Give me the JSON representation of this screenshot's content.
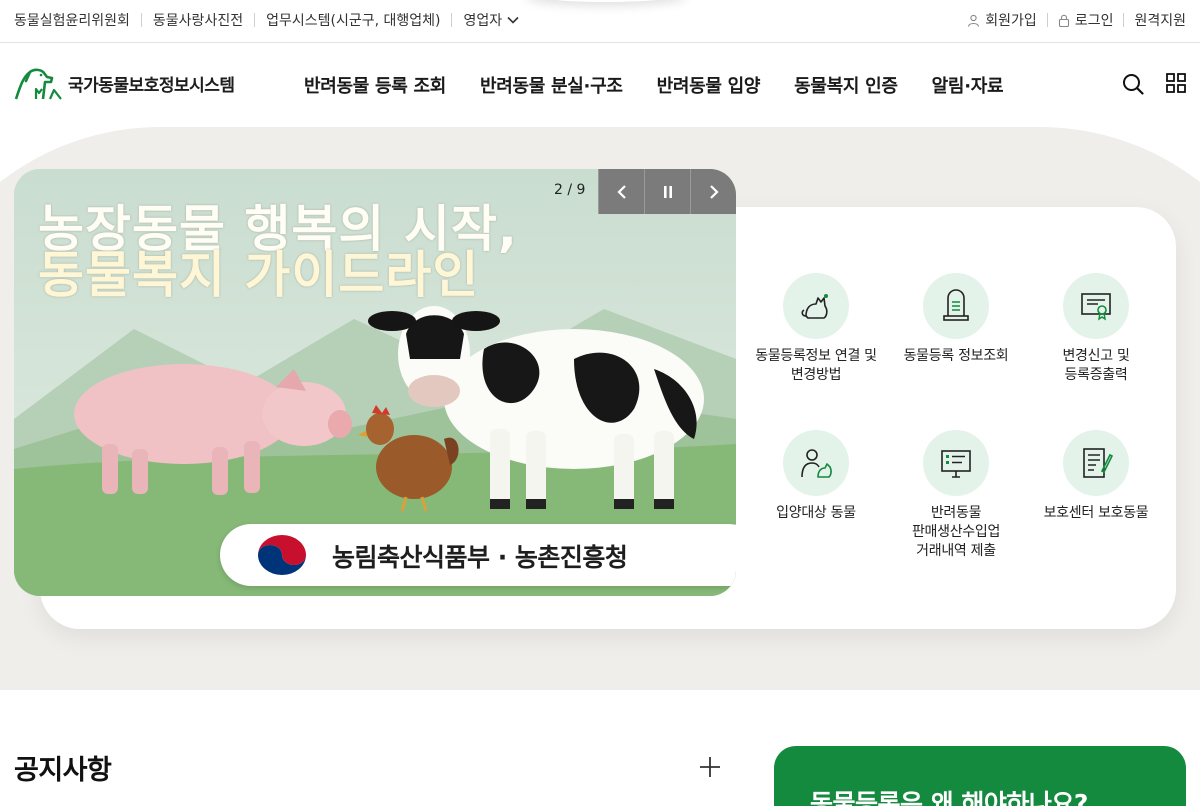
{
  "util_bar": {
    "left_links": [
      "동물실험윤리위원회",
      "동물사랑사진전",
      "업무시스템(시군구, 대행업체)",
      "영업자"
    ],
    "right_links": [
      "회원가입",
      "로그인",
      "원격지원"
    ]
  },
  "header": {
    "logo_text": "국가동물보호정보시스템",
    "nav": [
      "반려동물 등록 조회",
      "반려동물 분실·구조",
      "반려동물 입양",
      "동물복지 인증",
      "알림·자료"
    ]
  },
  "banner": {
    "counter": "2 / 9",
    "title_line1": "농장동물 행복의 시작,",
    "title_line2": "동물복지 가이드라인",
    "org_text": "농림축산식품부 · 농촌진흥청"
  },
  "quick_menu": [
    {
      "label": "동물등록정보 연결 및\n변경방법",
      "icon": "cat-icon"
    },
    {
      "label": "동물등록 정보조회",
      "icon": "tombstone-icon"
    },
    {
      "label": "변경신고 및\n등록증출력",
      "icon": "certificate-icon"
    },
    {
      "label": "입양대상 동물",
      "icon": "person-with-dog-icon"
    },
    {
      "label": "반려동물\n판매생산수입업\n거래내역 제출",
      "icon": "monitor-form-icon"
    },
    {
      "label": "보호센터 보호동물",
      "icon": "document-pen-icon"
    }
  ],
  "notice": {
    "title": "공지사항"
  },
  "promo": {
    "title": "동물등록은 왜 해야하나요?"
  },
  "colors": {
    "brand_green": "#138a3e",
    "icon_bg": "#e4f3ea",
    "section_bg": "#f0eeeb"
  }
}
